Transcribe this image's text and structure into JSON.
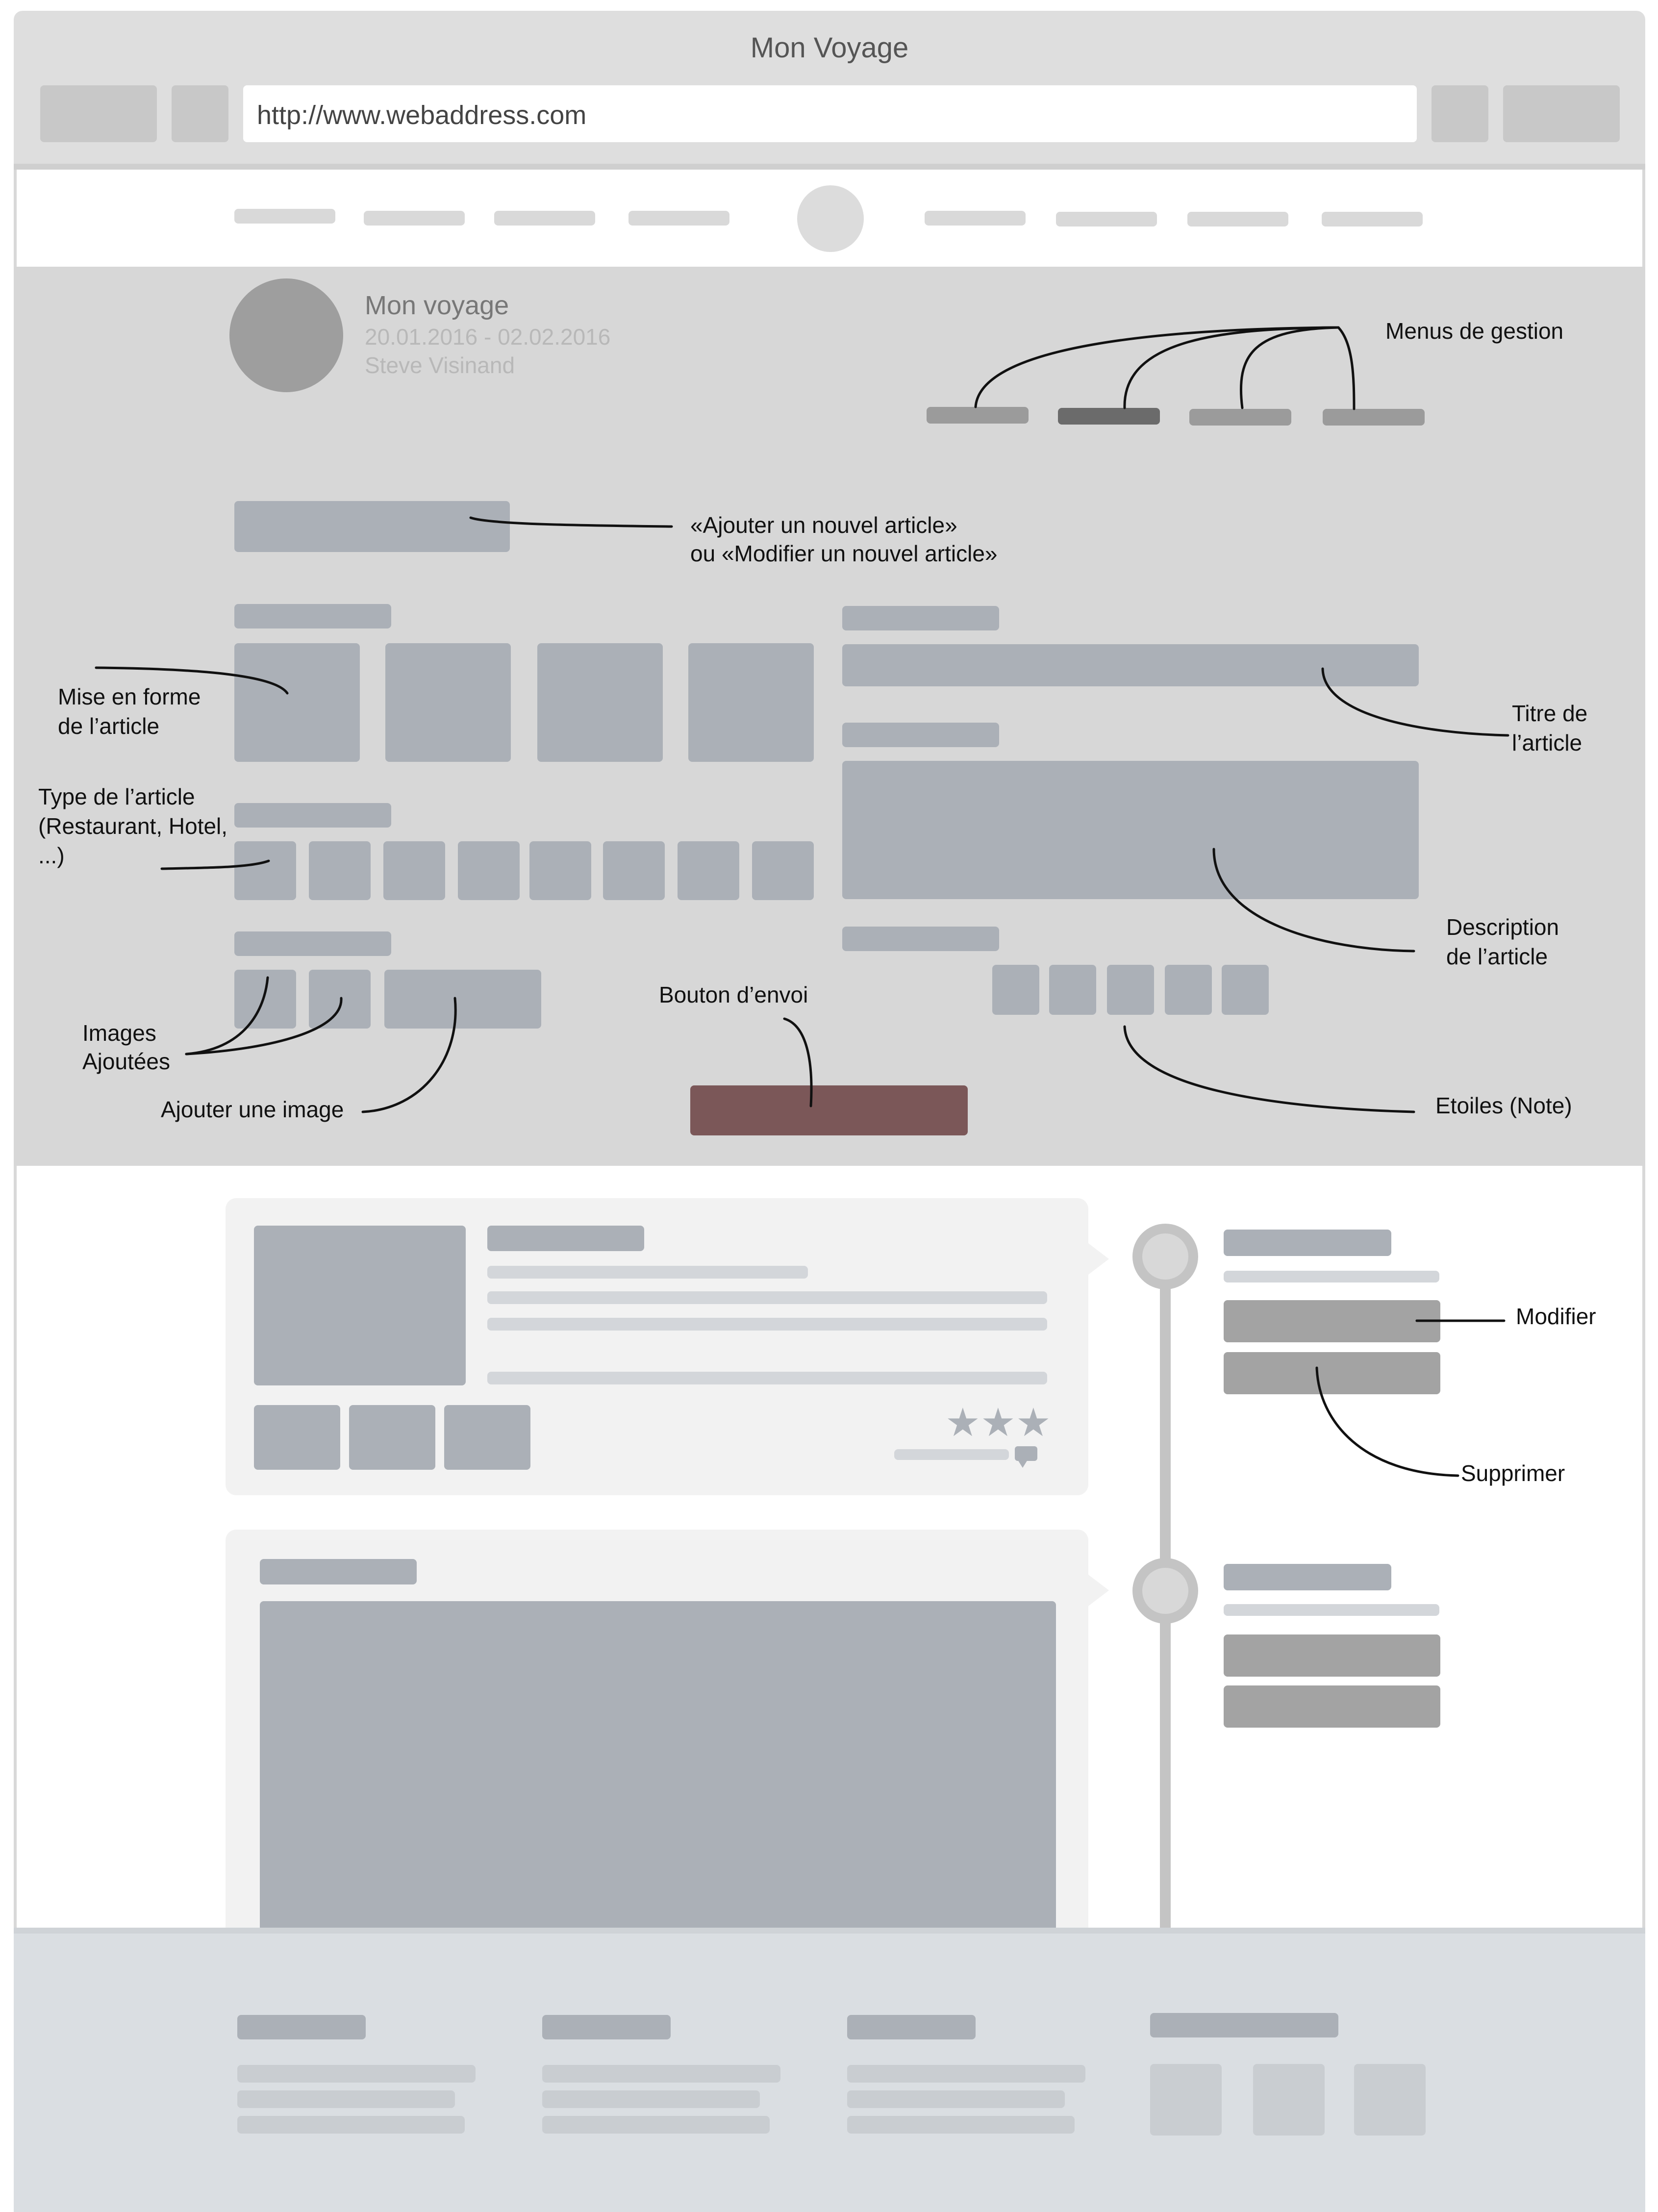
{
  "browser": {
    "title": "Mon Voyage",
    "url": "http://www.webaddress.com"
  },
  "trip": {
    "name": "Mon voyage",
    "dates": "20.01.2016 - 02.02.2016",
    "author": "Steve Visinand"
  },
  "annotations": {
    "menus_gestion": "Menus de gestion",
    "ajouter_line1": "«Ajouter un nouvel article»",
    "ajouter_line2": "ou «Modifier un nouvel article»",
    "mise_en_forme_line1": "Mise en forme",
    "mise_en_forme_line2": "de l’article",
    "type_line1": "Type de l’article",
    "type_line2": "(Restaurant, Hotel,",
    "type_line3": "...)",
    "titre_line1": "Titre de",
    "titre_line2": "l’article",
    "description_line1": "Description",
    "description_line2": "de l’article",
    "images_line1": "Images",
    "images_line2": "Ajoutées",
    "ajouter_image": "Ajouter une image",
    "bouton_envoi": "Bouton d’envoi",
    "etoiles": "Etoiles (Note)",
    "modifier": "Modifier",
    "supprimer": "Supprimer"
  },
  "colors": {
    "submit_button": "#7b5758",
    "active_menu": "#6b6b6b"
  },
  "icons": {
    "stars": "star-icon",
    "comment": "comment-bubble-icon"
  }
}
